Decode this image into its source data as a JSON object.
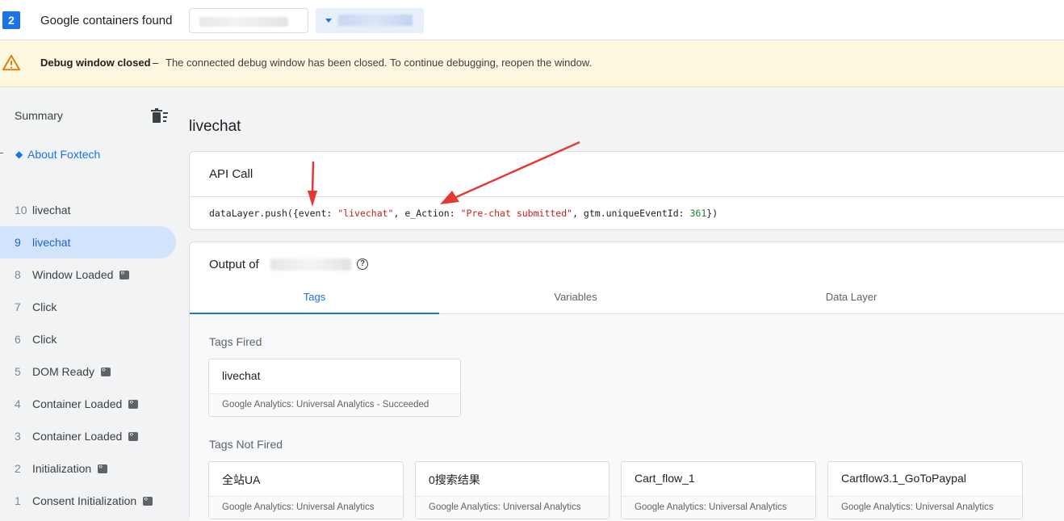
{
  "topbar": {
    "container_count": "2",
    "containers_found_label": "Google containers found"
  },
  "banner": {
    "title": "Debug window closed",
    "separator": "–",
    "message": "The connected debug window has been closed. To continue debugging, reopen the window."
  },
  "sidebar": {
    "summary_label": "Summary",
    "about_label": "About Foxtech",
    "events": [
      {
        "num": "10",
        "name": "livechat",
        "code": false,
        "active": false
      },
      {
        "num": "9",
        "name": "livechat",
        "code": false,
        "active": true
      },
      {
        "num": "8",
        "name": "Window Loaded",
        "code": true,
        "active": false
      },
      {
        "num": "7",
        "name": "Click",
        "code": false,
        "active": false
      },
      {
        "num": "6",
        "name": "Click",
        "code": false,
        "active": false
      },
      {
        "num": "5",
        "name": "DOM Ready",
        "code": true,
        "active": false
      },
      {
        "num": "4",
        "name": "Container Loaded",
        "code": true,
        "active": false
      },
      {
        "num": "3",
        "name": "Container Loaded",
        "code": true,
        "active": false
      },
      {
        "num": "2",
        "name": "Initialization",
        "code": true,
        "active": false
      },
      {
        "num": "1",
        "name": "Consent Initialization",
        "code": true,
        "active": false
      }
    ]
  },
  "main": {
    "page_title": "livechat",
    "api_card": {
      "heading": "API Call",
      "code_parts": {
        "p1": "dataLayer.push({event: ",
        "s1": "\"livechat\"",
        "p2": ", e_Action: ",
        "s2": "\"Pre-chat submitted\"",
        "p3": ", gtm.uniqueEventId: ",
        "n1": "361",
        "p4": "})"
      }
    },
    "output_card": {
      "heading": "Output of",
      "help_icon": "?",
      "tabs": [
        "Tags",
        "Variables",
        "Data Layer"
      ],
      "active_tab": "Tags",
      "fired_label": "Tags Fired",
      "not_fired_label": "Tags Not Fired",
      "fired": [
        {
          "name": "livechat",
          "type": "Google Analytics: Universal Analytics - Succeeded"
        }
      ],
      "not_fired": [
        {
          "name": "全站UA",
          "type": "Google Analytics: Universal Analytics"
        },
        {
          "name": "0搜索结果",
          "type": "Google Analytics: Universal Analytics"
        },
        {
          "name": "Cart_flow_1",
          "type": "Google Analytics: Universal Analytics"
        },
        {
          "name": "Cartflow3.1_GoToPaypal",
          "type": "Google Analytics: Universal Analytics"
        }
      ]
    }
  },
  "colors": {
    "accent": "#1a73e8",
    "active_item_bg": "#d2e3fc",
    "banner_bg": "#fef7e0",
    "string": "#c5221f",
    "number": "#188038",
    "annotation_arrow": "#e53935"
  },
  "icons": {
    "warning": "warning-triangle-icon",
    "trash": "delete-sweep-icon",
    "help": "help-circle-icon",
    "code": "code-badge-icon"
  }
}
